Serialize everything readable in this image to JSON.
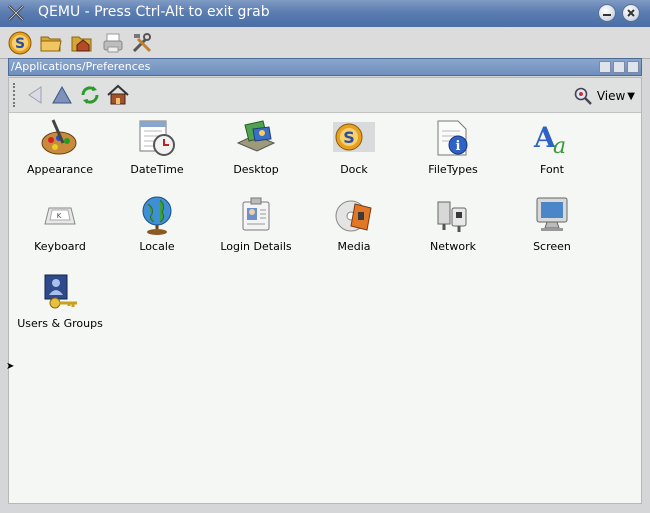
{
  "window": {
    "title": "QEMU - Press Ctrl-Alt to exit grab"
  },
  "toolbar": {
    "icons": [
      "settings-s-icon",
      "folder-open-icon",
      "home-folder-icon",
      "printer-icon",
      "tools-icon"
    ]
  },
  "path_bar": {
    "path": "/Applications/Preferences"
  },
  "nav": {
    "view_label": "View"
  },
  "items": [
    {
      "label": "Appearance",
      "icon": "appearance-icon"
    },
    {
      "label": "DateTime",
      "icon": "datetime-icon"
    },
    {
      "label": "Desktop",
      "icon": "desktop-icon"
    },
    {
      "label": "Dock",
      "icon": "dock-icon"
    },
    {
      "label": "FileTypes",
      "icon": "filetypes-icon"
    },
    {
      "label": "Font",
      "icon": "font-icon"
    },
    {
      "label": "Keyboard",
      "icon": "keyboard-icon"
    },
    {
      "label": "Locale",
      "icon": "globe-icon"
    },
    {
      "label": "Login Details",
      "icon": "login-details-icon"
    },
    {
      "label": "Media",
      "icon": "media-icon"
    },
    {
      "label": "Network",
      "icon": "network-icon"
    },
    {
      "label": "Screen",
      "icon": "screen-icon"
    },
    {
      "label": "Users & Groups",
      "icon": "users-groups-icon"
    }
  ],
  "colors": {
    "titlebar": "#5b7db1",
    "pathbar": "#7a98c4",
    "content_bg": "#f4f7f4"
  }
}
